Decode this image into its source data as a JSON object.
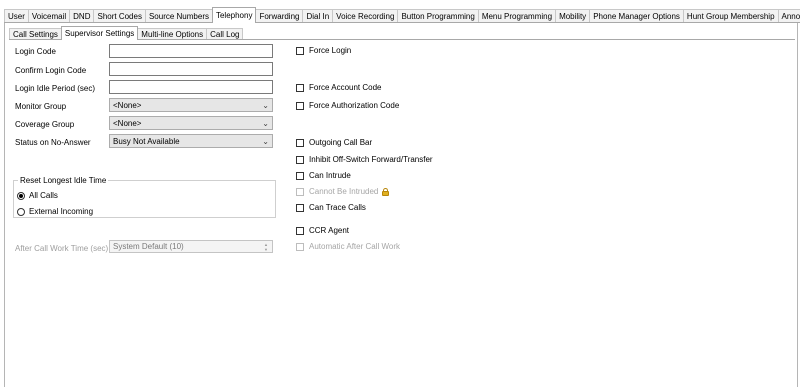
{
  "tabs_top": [
    "User",
    "Voicemail",
    "DND",
    "Short Codes",
    "Source Numbers",
    "Telephony",
    "Forwarding",
    "Dial In",
    "Voice Recording",
    "Button Programming",
    "Menu Programming",
    "Mobility",
    "Phone Manager Options",
    "Hunt Group Membership",
    "Announ"
  ],
  "tabs_sub": [
    "Call Settings",
    "Supervisor Settings",
    "Multi-line Options",
    "Call Log"
  ],
  "form": {
    "login_code_label": "Login Code",
    "confirm_login_code_label": "Confirm Login Code",
    "login_idle_period_label": "Login Idle Period (sec)",
    "monitor_group_label": "Monitor Group",
    "monitor_group_value": "<None>",
    "coverage_group_label": "Coverage Group",
    "coverage_group_value": "<None>",
    "status_no_answer_label": "Status on No-Answer",
    "status_no_answer_value": "Busy Not Available",
    "reset_idle_legend": "Reset Longest Idle Time",
    "radio_all_calls": "All Calls",
    "radio_external_incoming": "External Incoming",
    "after_call_work_label": "After Call Work Time (sec)",
    "after_call_work_value": "System Default (10)"
  },
  "checkboxes": {
    "force_login": "Force Login",
    "force_account_code": "Force Account Code",
    "force_authorization_code": "Force Authorization Code",
    "outgoing_call_bar": "Outgoing Call Bar",
    "inhibit_off_switch": "Inhibit Off-Switch Forward/Transfer",
    "can_intrude": "Can Intrude",
    "cannot_be_intruded": "Cannot Be Intruded",
    "can_trace_calls": "Can Trace Calls",
    "ccr_agent": "CCR Agent",
    "automatic_after_call_work": "Automatic After Call Work"
  }
}
